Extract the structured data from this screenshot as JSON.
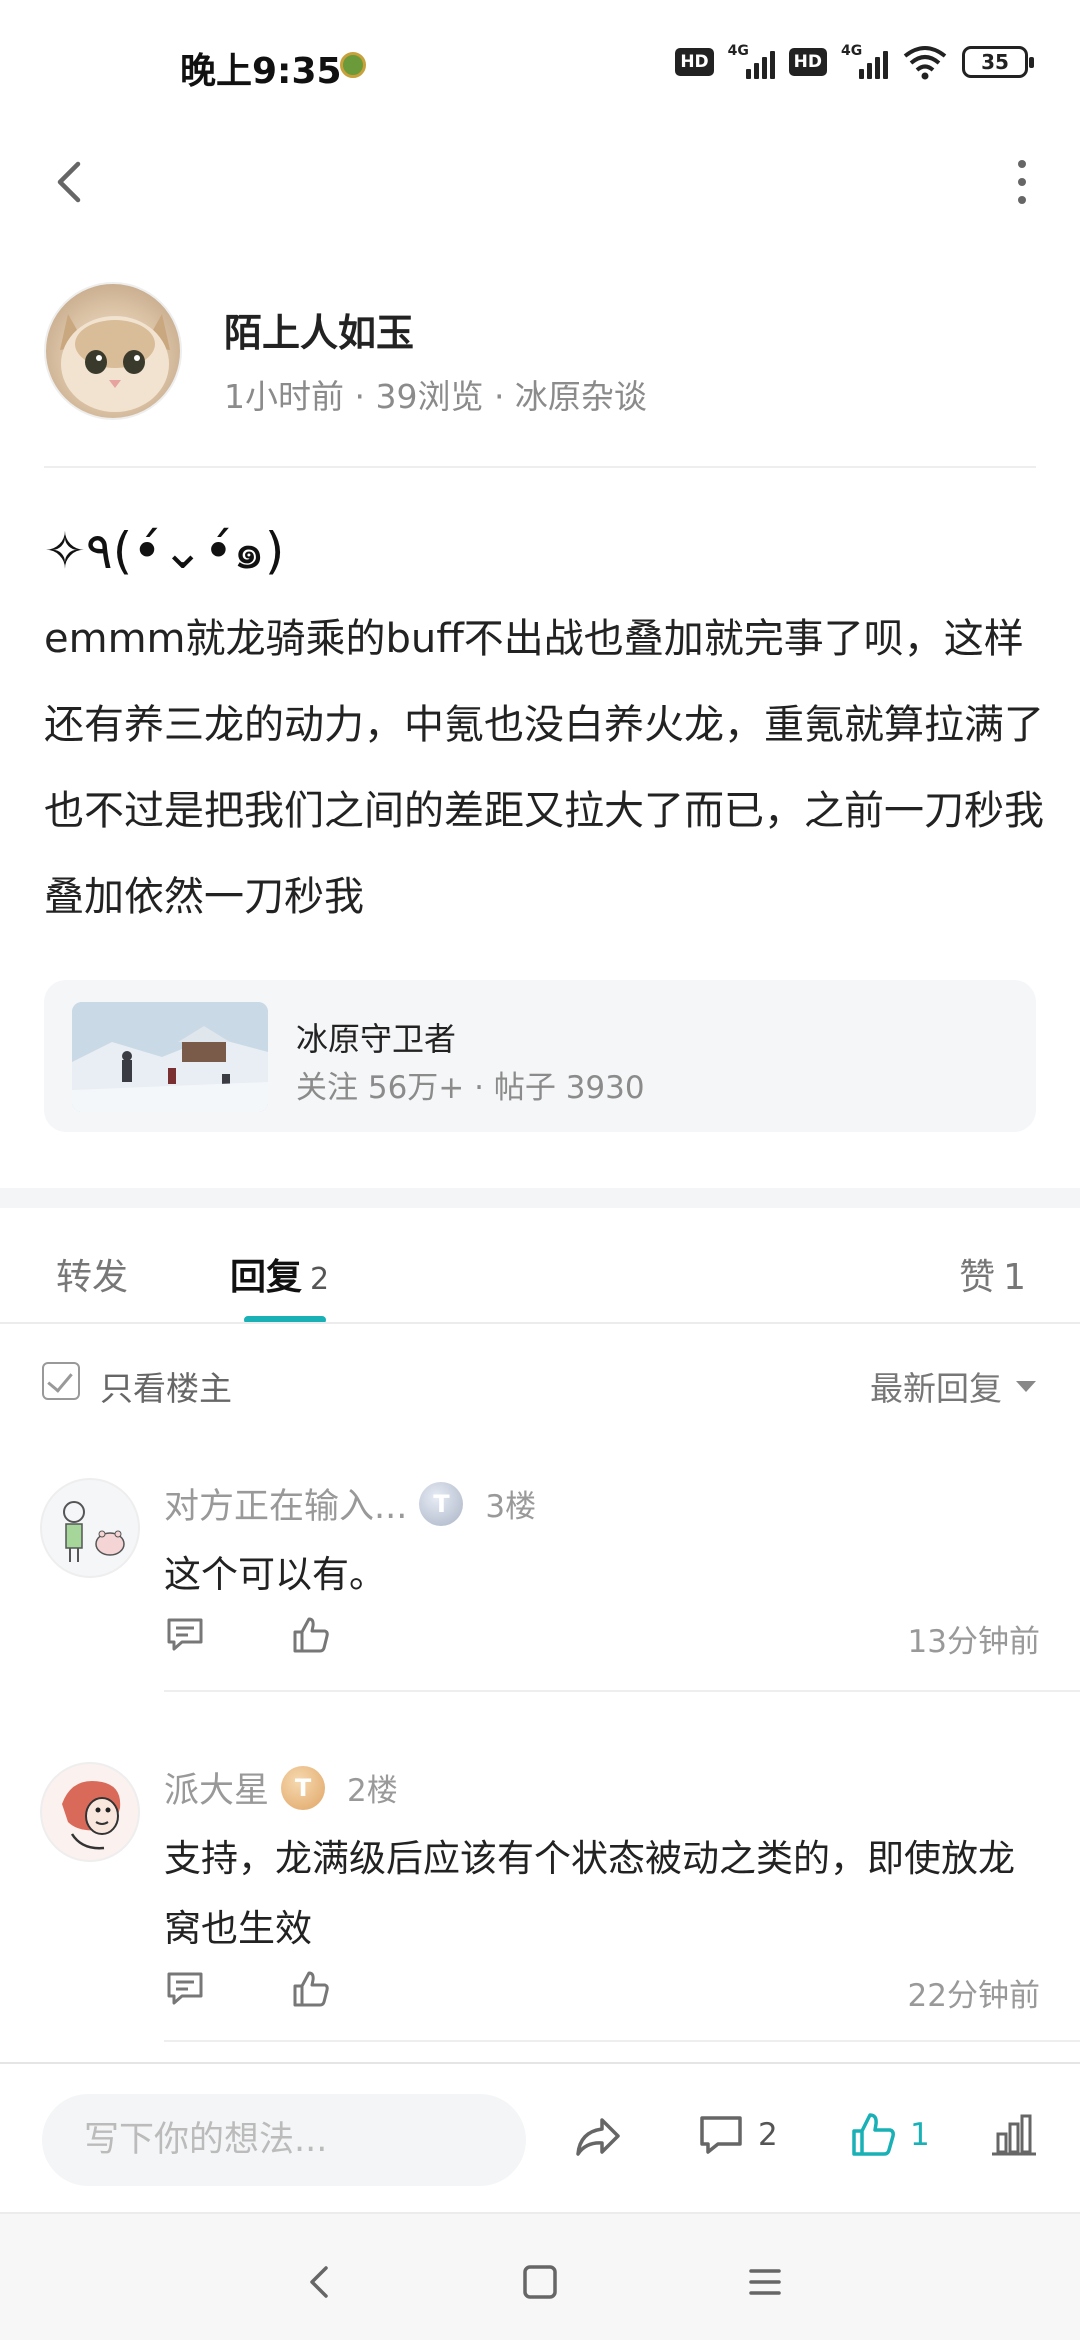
{
  "status_bar": {
    "time": "晚上9:35",
    "hd1": "HD",
    "net1": "4G",
    "hd2": "HD",
    "net2": "4G",
    "battery": "35"
  },
  "author": {
    "name": "陌上人如玉",
    "meta": "1小时前 · 39浏览 · 冰原杂谈"
  },
  "post": {
    "title": "✧٩(•́⌄•́๑)",
    "body": "emmm就龙骑乘的buff不出战也叠加就完事了呗，这样还有养三龙的动力，中氪也没白养火龙，重氪就算拉满了也不过是把我们之间的差距又拉大了而已，之前一刀秒我叠加依然一刀秒我"
  },
  "forum": {
    "name": "冰原守卫者",
    "meta": "关注 56万+ · 帖子 3930"
  },
  "tabs": {
    "repost": "转发",
    "reply": "回复",
    "reply_count": "2",
    "like": "赞",
    "like_count": "1"
  },
  "filter": {
    "only_author": "只看楼主",
    "sort": "最新回复"
  },
  "comments": [
    {
      "name": "对方正在输入...",
      "badge": "T",
      "floor": "3楼",
      "text": "这个可以有。",
      "time": "13分钟前"
    },
    {
      "name": "派大星",
      "badge": "T",
      "floor": "2楼",
      "text": "支持，龙满级后应该有个状态被动之类的，即使放龙窝也生效",
      "time": "22分钟前"
    }
  ],
  "bottom_bar": {
    "placeholder": "写下你的想法...",
    "comment_count": "2",
    "like_count": "1"
  },
  "colors": {
    "accent": "#19b0b6",
    "secondary_text": "#8b8b8b"
  },
  "icons": [
    "back-icon",
    "more-icon",
    "reply-icon",
    "thumb-up-icon",
    "share-icon",
    "comment-icon",
    "stats-icon",
    "checkbox-icon",
    "sort-dropdown-icon"
  ]
}
